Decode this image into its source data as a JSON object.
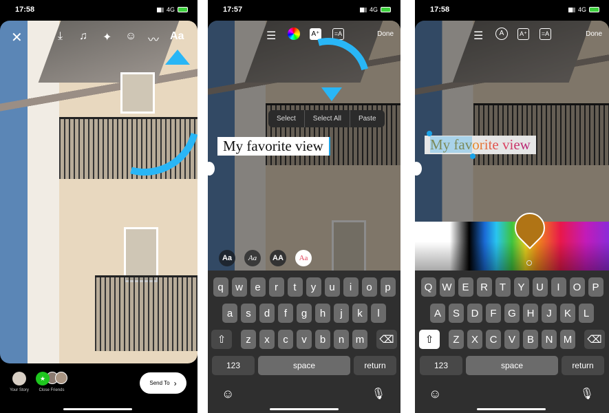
{
  "panel1": {
    "time": "17:58",
    "network": "4G",
    "toolbar": {
      "close": "close-icon",
      "download": "download-icon",
      "music": "music-icon",
      "effects": "sparkles-icon",
      "sticker": "sticker-icon",
      "draw": "draw-icon",
      "text": "Aa"
    },
    "bottom": {
      "your_story": "Your Story",
      "close_friends": "Close Friends",
      "send_to": "Send To"
    }
  },
  "panel2": {
    "time": "17:57",
    "network": "4G",
    "done": "Done",
    "menu": [
      "Select",
      "Select All",
      "Paste"
    ],
    "text": "My favorite view",
    "fonts": [
      "Aa",
      "Aa",
      "AA",
      "Aa"
    ],
    "keyboard": {
      "rows": [
        [
          "q",
          "w",
          "e",
          "r",
          "t",
          "y",
          "u",
          "i",
          "o",
          "p"
        ],
        [
          "a",
          "s",
          "d",
          "f",
          "g",
          "h",
          "j",
          "k",
          "l"
        ],
        [
          "z",
          "x",
          "c",
          "v",
          "b",
          "n",
          "m"
        ]
      ],
      "numbers": "123",
      "space": "space",
      "return": "return"
    }
  },
  "panel3": {
    "time": "17:58",
    "network": "4G",
    "done": "Done",
    "text_parts": [
      "My fav",
      "orite view"
    ],
    "picked_color": "#b07415",
    "keyboard": {
      "rows": [
        [
          "Q",
          "W",
          "E",
          "R",
          "T",
          "Y",
          "U",
          "I",
          "O",
          "P"
        ],
        [
          "A",
          "S",
          "D",
          "F",
          "G",
          "H",
          "J",
          "K",
          "L"
        ],
        [
          "Z",
          "X",
          "C",
          "V",
          "B",
          "N",
          "M"
        ]
      ],
      "numbers": "123",
      "space": "space",
      "return": "return"
    }
  },
  "colors": {
    "arrow": "#29b6f6",
    "selection": "#1aa3e8"
  }
}
